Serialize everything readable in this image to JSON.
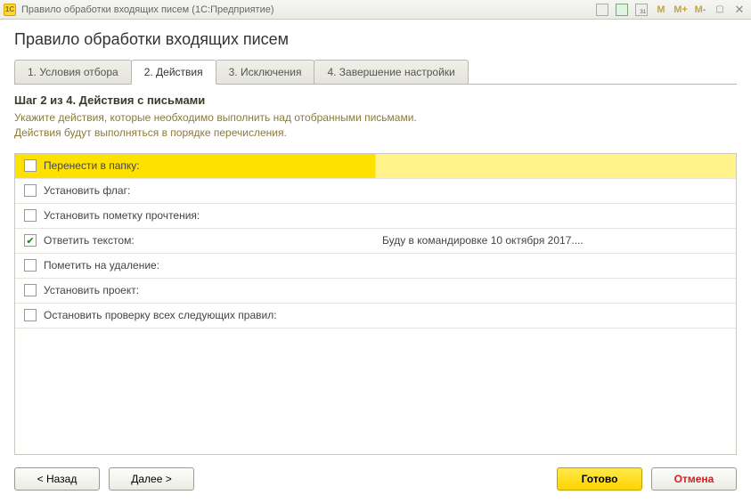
{
  "window": {
    "title": "Правило обработки входящих писем  (1С:Предприятие)",
    "icon_text": "1C"
  },
  "page_title": "Правило обработки входящих писем",
  "tabs": [
    {
      "label": "1. Условия отбора"
    },
    {
      "label": "2. Действия"
    },
    {
      "label": "3. Исключения"
    },
    {
      "label": "4. Завершение настройки"
    }
  ],
  "step": {
    "title": "Шаг 2 из 4. Действия с письмами",
    "desc1": "Укажите действия, которые необходимо выполнить над отобранными письмами.",
    "desc2": "Действия будут выполняться в порядке перечисления."
  },
  "actions": [
    {
      "label": "Перенести в папку:",
      "checked": false,
      "selected": true,
      "value": ""
    },
    {
      "label": "Установить флаг:",
      "checked": false,
      "value": ""
    },
    {
      "label": "Установить пометку прочтения:",
      "checked": false,
      "value": ""
    },
    {
      "label": "Ответить текстом:",
      "checked": true,
      "value": "Буду в командировке 10 октября 2017...."
    },
    {
      "label": "Пометить на удаление:",
      "checked": false,
      "value": ""
    },
    {
      "label": "Установить проект:",
      "checked": false,
      "value": ""
    },
    {
      "label": "Остановить проверку всех следующих правил:",
      "checked": false,
      "value": ""
    }
  ],
  "buttons": {
    "back": "< Назад",
    "next": "Далее >",
    "finish": "Готово",
    "cancel": "Отмена"
  },
  "titlebar_icons": {
    "cal_date": "31",
    "m": "M",
    "mplus": "M+",
    "mminus": "M-"
  }
}
